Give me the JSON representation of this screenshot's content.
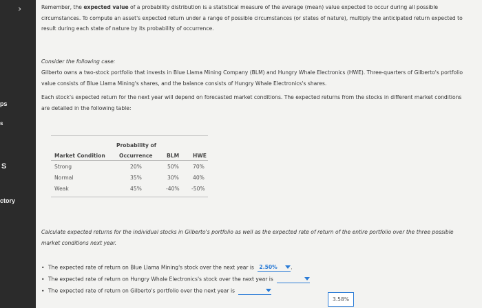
{
  "sidebar": {
    "chevron": "›",
    "labels": [
      "ps",
      "s",
      "S",
      "ctory"
    ]
  },
  "intro": {
    "text1": "Remember, the ",
    "bold": "expected value",
    "text2": " of a probability distribution is a statistical measure of the average (mean) value expected to occur during all possible circumstances. To compute an asset's expected return under a range of possible circumstances (or states of nature), multiply the anticipated return expected to result during each state of nature by its probability of occurrence."
  },
  "case_heading": "Consider the following case:",
  "case_text": "Gilberto owns a two-stock portfolio that invests in Blue Llama Mining Company (BLM) and Hungry Whale Electronics (HWE). Three-quarters of Gilberto's portfolio value consists of Blue Llama Mining's shares, and the balance consists of Hungry Whale Electronics's shares.",
  "returns_text": "Each stock's expected return for the next year will depend on forecasted market conditions. The expected returns from the stocks in different market conditions are detailed in the following table:",
  "table": {
    "headers": {
      "condition": "Market Condition",
      "prob_line1": "Probability of",
      "prob_line2": "Occurrence",
      "blm": "BLM",
      "hwe": "HWE"
    },
    "rows": [
      {
        "condition": "Strong",
        "prob": "20%",
        "blm": "50%",
        "hwe": "70%"
      },
      {
        "condition": "Normal",
        "prob": "35%",
        "blm": "30%",
        "hwe": "40%"
      },
      {
        "condition": "Weak",
        "prob": "45%",
        "blm": "-40%",
        "hwe": "-50%"
      }
    ]
  },
  "question": "Calculate expected returns for the individual stocks in Gilberto's portfolio as well as the expected rate of return of the entire portfolio over the three possible market conditions next year.",
  "bullets": [
    {
      "text": "The expected rate of return on Blue Llama Mining's stock over the next year is",
      "value": "2.50%",
      "suffix": "."
    },
    {
      "text": "The expected rate of return on Hungry Whale Electronics's stock over the next year is",
      "value": "",
      "suffix": ""
    },
    {
      "text": "The expected rate of return on Gilberto's portfolio over the next year is",
      "value": "",
      "suffix": ""
    }
  ],
  "dropdown_option": "3.58%",
  "colors": {
    "accent": "#2a7bd6",
    "sidebar": "#2b2b2b"
  }
}
